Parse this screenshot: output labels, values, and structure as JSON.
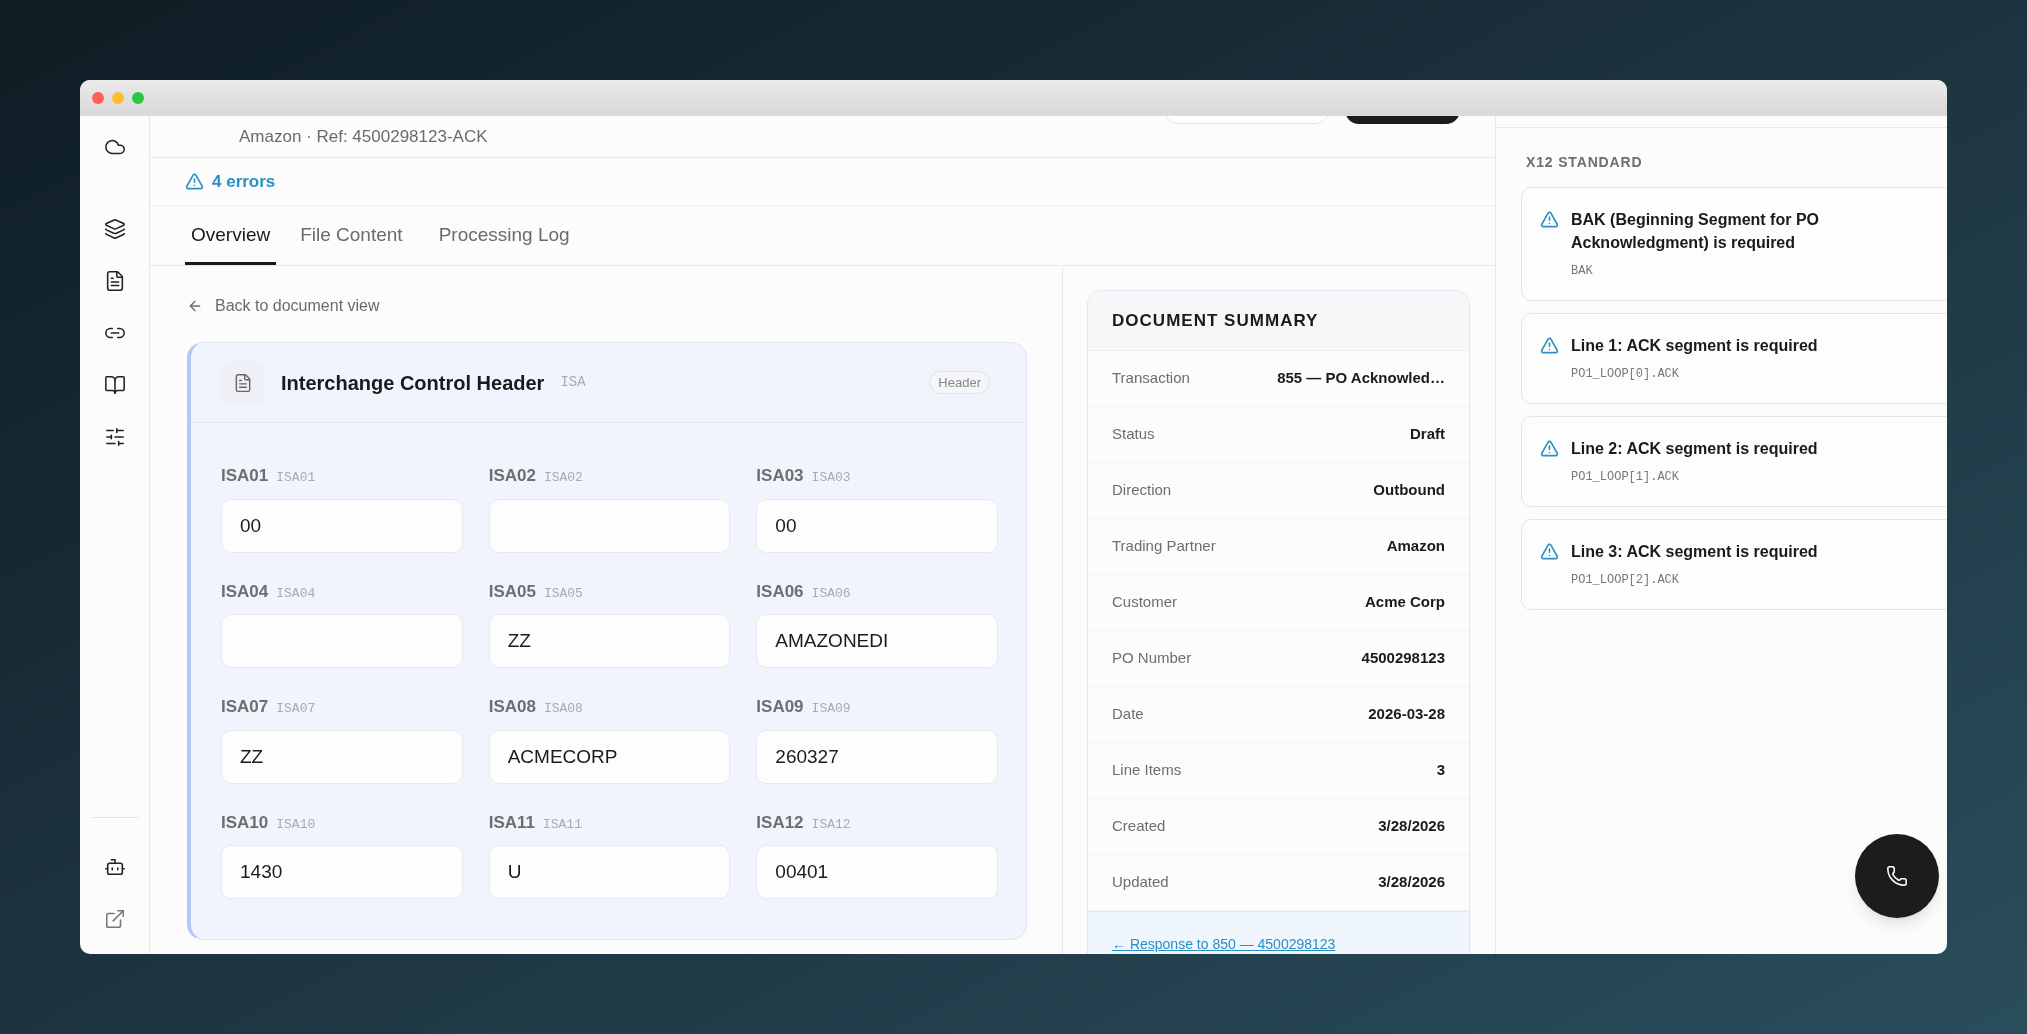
{
  "header": {
    "subtitle": "Amazon · Ref: 4500298123-ACK"
  },
  "errors_link": "4 errors",
  "tabs": [
    {
      "label": "Overview",
      "selected": true
    },
    {
      "label": "File Content",
      "selected": false
    },
    {
      "label": "Processing Log",
      "selected": false
    }
  ],
  "back_link": "Back to document view",
  "segment": {
    "title": "Interchange Control Header",
    "code": "ISA",
    "badge": "Header",
    "fields": [
      {
        "label": "ISA01",
        "code": "ISA01",
        "value": "00"
      },
      {
        "label": "ISA02",
        "code": "ISA02"
      },
      {
        "label": "ISA03",
        "code": "ISA03",
        "value": "00"
      },
      {
        "label": "ISA04",
        "code": "ISA04"
      },
      {
        "label": "ISA05",
        "code": "ISA05",
        "value": "ZZ"
      },
      {
        "label": "ISA06",
        "code": "ISA06",
        "value": "AMAZONEDI"
      },
      {
        "label": "ISA07",
        "code": "ISA07",
        "value": "ZZ"
      },
      {
        "label": "ISA08",
        "code": "ISA08",
        "value": "ACMECORP"
      },
      {
        "label": "ISA09",
        "code": "ISA09",
        "value": "260327"
      },
      {
        "label": "ISA10",
        "code": "ISA10",
        "value": "1430"
      },
      {
        "label": "ISA11",
        "code": "ISA11",
        "value": "U"
      },
      {
        "label": "ISA12",
        "code": "ISA12",
        "value": "00401"
      }
    ]
  },
  "summary": {
    "title": "DOCUMENT SUMMARY",
    "rows": [
      {
        "label": "Transaction",
        "value": "855 — PO Acknowled…"
      },
      {
        "label": "Status",
        "value": "Draft"
      },
      {
        "label": "Direction",
        "value": "Outbound"
      },
      {
        "label": "Trading Partner",
        "value": "Amazon"
      },
      {
        "label": "Customer",
        "value": "Acme Corp"
      },
      {
        "label": "PO Number",
        "value": "4500298123"
      },
      {
        "label": "Date",
        "value": "2026-03-28"
      },
      {
        "label": "Line Items",
        "value": "3"
      },
      {
        "label": "Created",
        "value": "3/28/2026"
      },
      {
        "label": "Updated",
        "value": "3/28/2026"
      }
    ],
    "link": "← Response to 850 — 4500298123"
  },
  "validation": {
    "section": "X12 STANDARD",
    "errors": [
      {
        "message": "BAK (Beginning Segment for PO Acknowledgment) is required",
        "path": "BAK"
      },
      {
        "message": "Line 1: ACK segment is required",
        "path": "PO1_LOOP[0].ACK"
      },
      {
        "message": "Line 2: ACK segment is required",
        "path": "PO1_LOOP[1].ACK"
      },
      {
        "message": "Line 3: ACK segment is required",
        "path": "PO1_LOOP[2].ACK"
      }
    ]
  }
}
